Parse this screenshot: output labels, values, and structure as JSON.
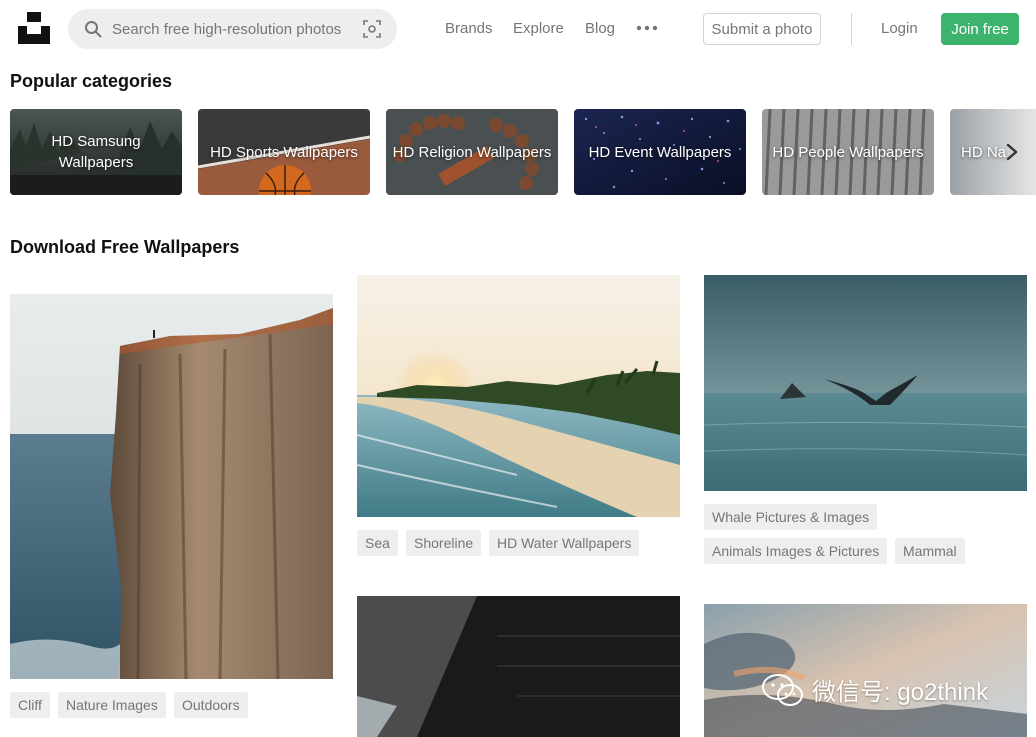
{
  "header": {
    "search_placeholder": "Search free high-resolution photos",
    "nav": [
      "Brands",
      "Explore",
      "Blog"
    ],
    "submit_label": "Submit a photo",
    "login_label": "Login",
    "join_label": "Join free",
    "icons": [
      "unsplash-logo",
      "search-icon",
      "visual-search-icon",
      "more-icon"
    ]
  },
  "categories": {
    "heading": "Popular categories",
    "items": [
      {
        "label": "HD Samsung Wallpapers"
      },
      {
        "label": "HD Sports Wallpapers"
      },
      {
        "label": "HD Religion Wallpapers"
      },
      {
        "label": "HD Event Wallpapers"
      },
      {
        "label": "HD People Wallpapers"
      },
      {
        "label": "HD Na"
      }
    ]
  },
  "gallery": {
    "heading": "Download Free Wallpapers",
    "photos": [
      {
        "subject": "cliff",
        "tags": [
          "Cliff",
          "Nature Images",
          "Outdoors"
        ]
      },
      {
        "subject": "beach",
        "tags": [
          "Sea",
          "Shoreline",
          "HD Water Wallpapers"
        ]
      },
      {
        "subject": "whale",
        "tags": [
          "Whale Pictures & Images",
          "Animals Images & Pictures",
          "Mammal"
        ]
      },
      {
        "subject": "dark-interior",
        "tags": []
      },
      {
        "subject": "sky",
        "tags": []
      }
    ]
  },
  "watermark": {
    "text": "微信号: go2think"
  },
  "colors": {
    "accent": "#3cb46e",
    "tag_bg": "#eeeeee",
    "muted_text": "#767676"
  }
}
